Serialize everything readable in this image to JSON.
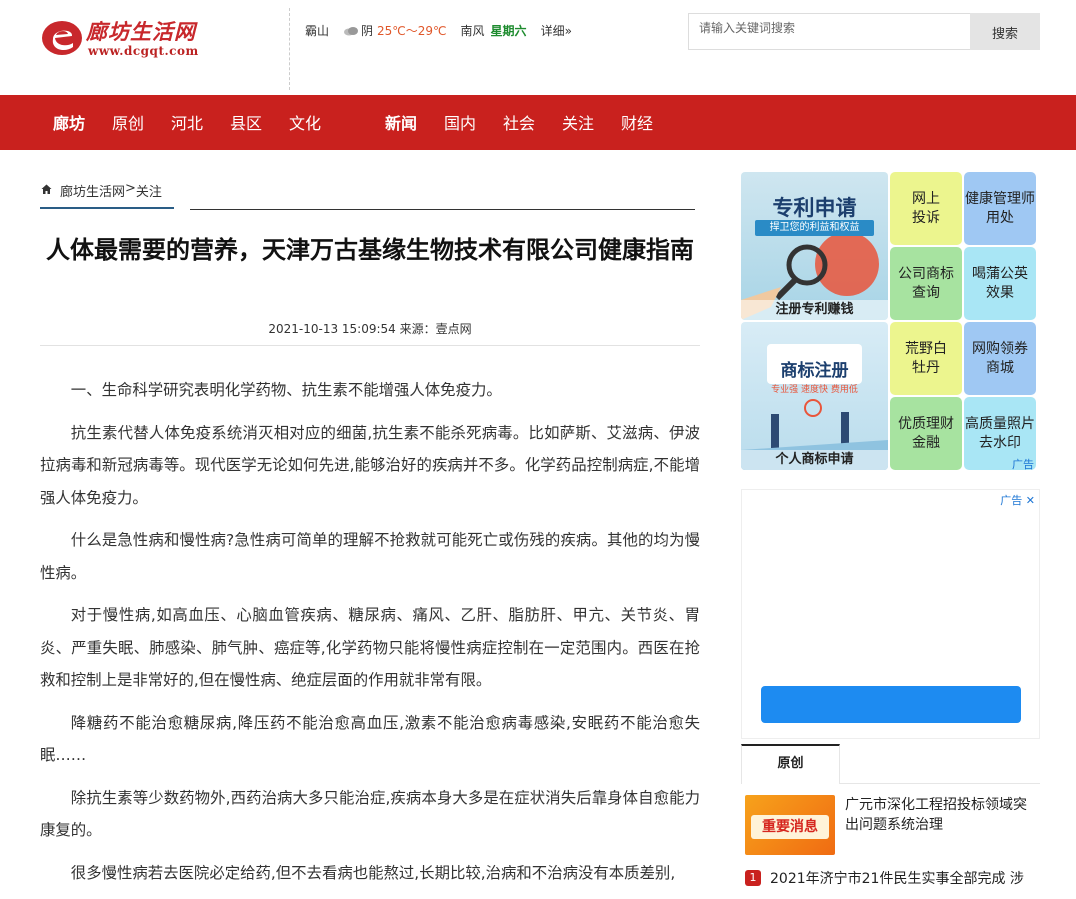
{
  "header": {
    "logo_text": "廊坊生活网",
    "logo_url": "www.dcgqt.com",
    "weather": {
      "city": "霸山",
      "condition": "阴",
      "temperature": "25℃～29℃",
      "wind": "南风",
      "weekday": "星期六",
      "details_link": "详细»"
    },
    "search": {
      "placeholder": "请输入关键词搜索",
      "button_label": "搜索"
    }
  },
  "nav": {
    "items": [
      {
        "label": "廊坊"
      },
      {
        "label": "原创"
      },
      {
        "label": "河北"
      },
      {
        "label": "县区"
      },
      {
        "label": "文化"
      },
      {
        "label": "新闻"
      },
      {
        "label": "国内"
      },
      {
        "label": "社会"
      },
      {
        "label": "关注"
      },
      {
        "label": "财经"
      }
    ]
  },
  "breadcrumb": {
    "home": "廊坊生活网",
    "separator": ">",
    "current": "关注"
  },
  "article": {
    "title": "人体最需要的营养，天津万古基缘生物技术有限公司健康指南",
    "meta": "2021-10-13 15:09:54 来源：壹点网",
    "paragraphs": [
      "一、生命科学研究表明化学药物、抗生素不能增强人体免疫力。",
      "抗生素代替人体免疫系统消灭相对应的细菌,抗生素不能杀死病毒。比如萨斯、艾滋病、伊波拉病毒和新冠病毒等。现代医学无论如何先进,能够治好的疾病并不多。化学药品控制病症,不能增强人体免疫力。",
      "什么是急性病和慢性病?急性病可简单的理解不抢救就可能死亡或伤残的疾病。其他的均为慢性病。",
      "对于慢性病,如高血压、心脑血管疾病、糖尿病、痛风、乙肝、脂肪肝、甲亢、关节炎、胃炎、严重失眠、肺感染、肺气肿、癌症等,化学药物只能将慢性病症控制在一定范围内。西医在抢救和控制上是非常好的,但在慢性病、绝症层面的作用就非常有限。",
      "降糖药不能治愈糖尿病,降压药不能治愈高血压,激素不能治愈病毒感染,安眠药不能治愈失眠……",
      "除抗生素等少数药物外,西药治病大多只能治症,疾病本身大多是在症状消失后靠身体自愈能力康复的。",
      "很多慢性病若去医院必定给药,但不去看病也能熬过,长期比较,治病和不治病没有本质差别,"
    ]
  },
  "sidebar": {
    "ad_patent": {
      "headline": "专利申请",
      "subline": "捍卫您的利益和权益",
      "caption": "注册专利赚钱"
    },
    "ad_trademark": {
      "headline": "商标注册",
      "subline": "专业强 速度快 费用低",
      "caption": "个人商标申请"
    },
    "tiles": [
      {
        "label": "网上投诉",
        "color": "#ecf58e"
      },
      {
        "label": "健康管理师用处",
        "color": "#9fc8f3"
      },
      {
        "label": "公司商标查询",
        "color": "#a7e3a0"
      },
      {
        "label": "喝蒲公英效果",
        "color": "#a9e6f5"
      },
      {
        "label": "荒野白牡丹",
        "color": "#ecf58e"
      },
      {
        "label": "网购领券商城",
        "color": "#9fc8f3"
      },
      {
        "label": "优质理财金融",
        "color": "#a7e3a0"
      },
      {
        "label": "高质量照片去水印",
        "color": "#a9e6f5"
      }
    ],
    "ad_label": "广告",
    "ad_box_label": "广告",
    "tab_label": "原创",
    "news": [
      {
        "thumb_text": "重要消息",
        "title": "广元市深化工程招投标领域突出问题系统治理"
      },
      {
        "rank": "1",
        "title": "2021年济宁市21件民生实事全部完成 涉"
      }
    ]
  }
}
